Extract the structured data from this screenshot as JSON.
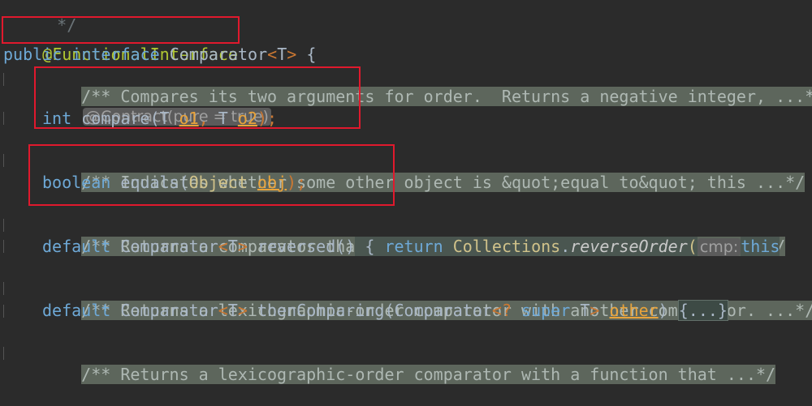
{
  "lines": {
    "l0": "*/",
    "l1_ann": "@FunctionalInterface",
    "l2_public": "public",
    "l2_interface": "interface",
    "l2_name": "Comparator",
    "l2_lt": "<",
    "l2_T": "T",
    "l2_gt": ">",
    "l2_brace": " {",
    "l3_doc": "/** Compares its two arguments for order.  Returns a negative integer, ...*/",
    "l4_hint": "@Contract(pure = true)",
    "l5_int": "int",
    "l5_rest": " compare(T ",
    "l5_o1": "o1",
    "l5_comma": ",",
    "l5_T2": " T ",
    "l5_o2": "o2",
    "l5_end": ");",
    "l6_doc": "/** Indicates whether some other object is &quot;equal to&quot; this ...*/",
    "l7_boolean": "boolean",
    "l7_equals": " equals(",
    "l7_object": "Object",
    "l7_obj": "obj",
    "l7_end": ");",
    "l8_doc": "/** Returns a comparator that imposes the reverse ordering of this ...*/",
    "l9_default": "default",
    "l9_comparator": " Comparator",
    "l9_reversed": " reversed()",
    "l9_brace": " { ",
    "l9_return": "return",
    "l9_collections": "Collections",
    "l9_dot": ".",
    "l9_reverseOrder": "reverseOrder",
    "l9_paren": "(",
    "l9_hint": "cmp:",
    "l9_this": "this",
    "l10_doc": "/** Returns a lexicographic-order comparator with another comparator. ...*/",
    "l11_default": "default",
    "l11_comparator": " Comparator",
    "l11_then": " thenComparing(Comparator",
    "l11_q": "?",
    "l11_super": " super",
    "l11_other": "other",
    "l11_fold": "{...}",
    "l12_doc": "/** Returns a lexicographic-order comparator with a function that ...*/"
  },
  "colors": {
    "background": "#2b2b2b",
    "keyword": "#6ea9d7",
    "annotation": "#b2c832",
    "highlight_box": "#e0192d"
  }
}
